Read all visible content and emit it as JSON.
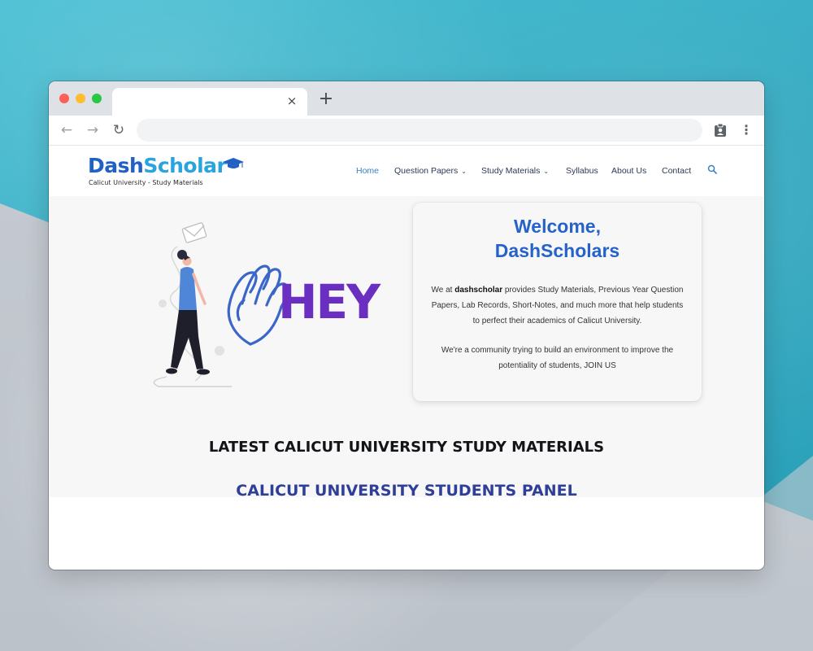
{
  "browser": {
    "tab_close": "×",
    "new_tab": "+",
    "back_icon": "←",
    "forward_icon": "→",
    "reload_icon": "↻",
    "menu_icon": "⋮"
  },
  "site": {
    "logo_part1": "Dash",
    "logo_part2": "Scholar",
    "tagline": "Calicut University - Study Materials",
    "nav": [
      {
        "label": "Home",
        "active": true
      },
      {
        "label": "Question Papers",
        "dropdown": true
      },
      {
        "label": "Study Materials",
        "dropdown": true
      },
      {
        "label": "Syllabus"
      },
      {
        "label": "About Us"
      },
      {
        "label": "Contact"
      }
    ],
    "dropdown_chevron": "⌄"
  },
  "hero": {
    "illustration_text": "HEY",
    "title_line1": "Welcome,",
    "title_line2": "DashScholars",
    "para1_prefix": "We at ",
    "para1_brand": "dashscholar",
    "para1_suffix": " provides Study Materials, Previous Year Question Papers, Lab Records, Short-Notes, and much more that help students to perfect their academics of Calicut University.",
    "para2": "We're a community trying to build an environment to improve the potentiality of students, JOIN US"
  },
  "sections": {
    "latest_title": "LATEST CALICUT UNIVERSITY STUDY MATERIALS",
    "panel_title": "CALICUT UNIVERSITY STUDENTS PANEL"
  },
  "colors": {
    "brand_blue": "#2160c4",
    "brand_light": "#29a4df",
    "card_title": "#2563c9",
    "panel_title": "#2f3f98",
    "hey_purple": "#6a2fc0"
  }
}
